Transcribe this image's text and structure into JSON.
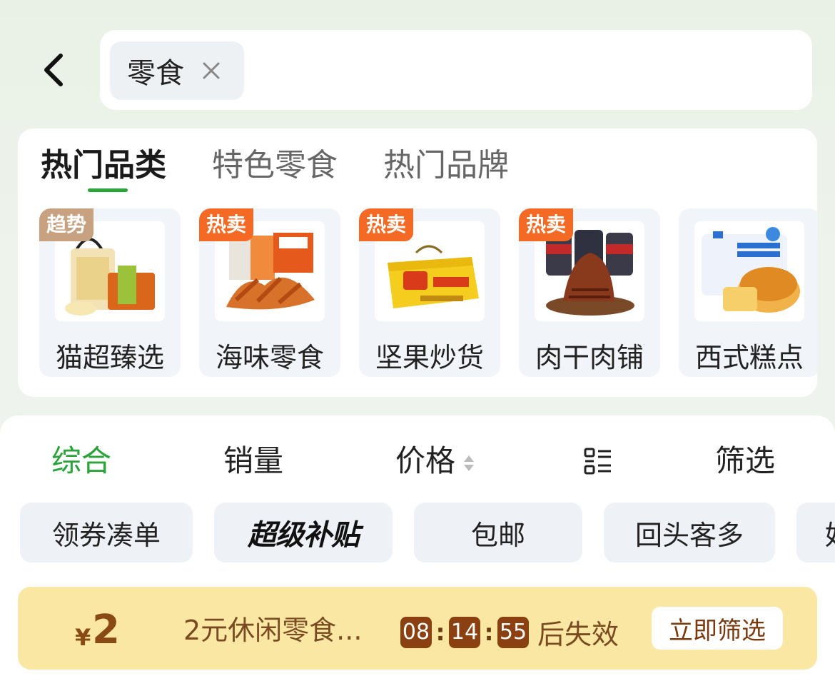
{
  "header": {
    "search_chip": {
      "text": "零食"
    }
  },
  "category_tabs": [
    {
      "label": "热门品类",
      "active": true
    },
    {
      "label": "特色零食",
      "active": false
    },
    {
      "label": "热门品牌",
      "active": false
    }
  ],
  "category_cards": [
    {
      "label": "猫超臻选",
      "badge": "趋势",
      "badge_type": "trend"
    },
    {
      "label": "海味零食",
      "badge": "热卖",
      "badge_type": "hot"
    },
    {
      "label": "坚果炒货",
      "badge": "热卖",
      "badge_type": "hot"
    },
    {
      "label": "肉干肉铺",
      "badge": "热卖",
      "badge_type": "hot"
    },
    {
      "label": "西式糕点",
      "badge": "",
      "badge_type": ""
    }
  ],
  "sort_bar": {
    "comprehensive": "综合",
    "sales": "销量",
    "price": "价格",
    "filter": "筛选"
  },
  "filter_chips": [
    "领券凑单",
    "超级补贴",
    "包邮",
    "回头客多",
    "好"
  ],
  "promo": {
    "currency": "¥",
    "amount": "2",
    "text": "2元休闲零食...",
    "countdown": {
      "hours": "08",
      "minutes": "14",
      "seconds": "55"
    },
    "suffix": "后失效",
    "button": "立即筛选"
  },
  "colors": {
    "accent_green": "#2ba33b",
    "badge_hot": "#f46a25",
    "badge_trend": "#c8a280",
    "promo_bg": "#fbe7a4",
    "promo_text": "#8a4a14"
  }
}
